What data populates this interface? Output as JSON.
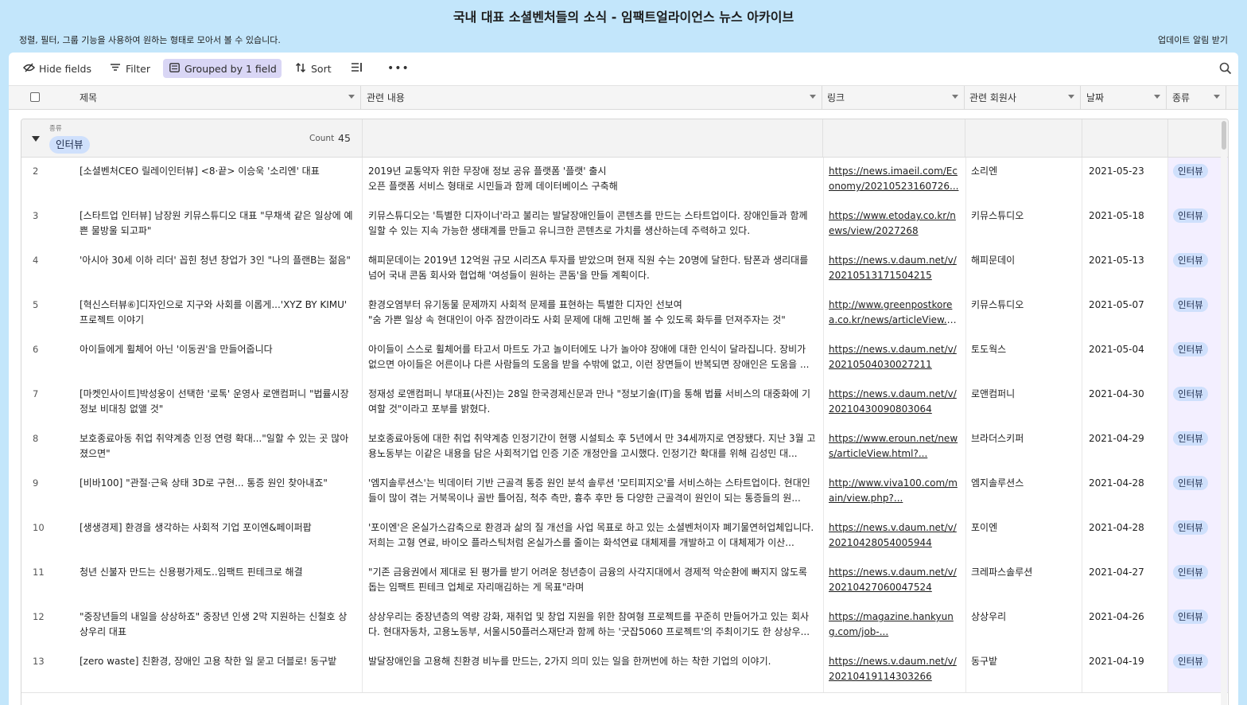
{
  "header": {
    "title": "국내 대표 소셜벤처들의 소식 - 임팩트얼라이언스 뉴스 아카이브",
    "description": "정렬, 필터, 그룹 기능을 사용하여 원하는 형태로 모아서 볼 수 있습니다.",
    "subscribe_label": "업데이트 알림 받기"
  },
  "toolbar": {
    "hide_fields": "Hide fields",
    "filter": "Filter",
    "grouped": "Grouped by 1 field",
    "sort": "Sort",
    "row_height_icon": "row-height-icon",
    "more_icon": "more-icon",
    "search_icon": "search-icon"
  },
  "columns": [
    "제목",
    "관련 내용",
    "링크",
    "관련 회원사",
    "날짜",
    "종류"
  ],
  "group": {
    "field_label": "종류",
    "value": "인터뷰",
    "count_label": "Count",
    "count": "45"
  },
  "rows": [
    {
      "num": "2",
      "title": "[소셜벤처CEO 릴레이인터뷰] <8·끝> 이승욱 '소리엔' 대표",
      "content": "2019년 교통약자 위한 무장애 정보 공유 플랫폼 '플랫' 출시\n오픈 플랫폼 서비스 형태로 시민들과 함께 데이터베이스 구축해",
      "link": "https://news.imaeil.com/Economy/20210523160726...",
      "member": "소리엔",
      "date": "2021-05-23",
      "type": "인터뷰"
    },
    {
      "num": "3",
      "title": "[스타트업 인터뷰] 남장원 키뮤스튜디오 대표 \"무채색 같은 일상에 예쁜 물방울 되고파\"",
      "content": "키뮤스튜디오는 '특별한 디자이너'라고 불리는 발달장애인들이 콘텐츠를 만드는 스타트업이다. 장애인들과 함께 일할 수 있는 지속 가능한 생태계를 만들고 유니크한 콘텐츠로 가치를 생산하는데 주력하고 있다.",
      "link": "https://www.etoday.co.kr/news/view/2027268",
      "member": "키뮤스튜디오",
      "date": "2021-05-18",
      "type": "인터뷰"
    },
    {
      "num": "4",
      "title": "'아시아 30세 이하 리더' 꼽힌 청년 창업가 3인 \"나의 플랜B는 젊음\"",
      "content": "해피문데이는 2019년 12억원 규모 시리즈A 투자를 받았으며 현재 직원 수는 20명에 달한다. 탐폰과 생리대를 넘어 국내 콘돔 회사와 협업해 '여성들이 원하는 콘돔'을 만들 계획이다.",
      "link": "https://news.v.daum.net/v/20210513171504215",
      "member": "해피문데이",
      "date": "2021-05-13",
      "type": "인터뷰"
    },
    {
      "num": "5",
      "title": "[혁신스터뷰⑥]디자인으로 지구와 사회를 이롭게...'XYZ BY KIMU' 프로젝트 이야기",
      "content": "환경오염부터 유기동물 문제까지 사회적 문제를 표현하는 특별한 디자인 선보여\n\"숨 가쁜 일상 속 현대인이 아주 잠깐이라도 사회 문제에 대해 고민해 볼 수 있도록 화두를 던져주자는 것\"",
      "link": "http://www.greenpostkorea.co.kr/news/articleView.ht...",
      "member": "키뮤스튜디오",
      "date": "2021-05-07",
      "type": "인터뷰"
    },
    {
      "num": "6",
      "title": "아이들에게 휠체어 아닌 '이동권'을 만들어줍니다",
      "content": "아이들이 스스로 휠체어를 타고서 마트도 가고 놀이터에도 나가 놀아야 장애에 대한 인식이 달라집니다. 장비가 없으면 아이들은 어른이나 다른 사람들의 도움을 받을 수밖에 없고, 이런 장면들이 반복되면 장애인은 도움을 ...",
      "link": "https://news.v.daum.net/v/20210504030027211",
      "member": "토도웍스",
      "date": "2021-05-04",
      "type": "인터뷰"
    },
    {
      "num": "7",
      "title": "[마켓인사이트]박성웅이 선택한 '로톡' 운영사 로앤컴퍼니 \"법률시장 정보 비대칭 없앨 것\"",
      "content": "정재성 로앤컴퍼니 부대표(사진)는 28일 한국경제신문과 만나 \"정보기술(IT)을 통해 법률 서비스의 대중화에 기여할 것\"이라고 포부를 밝혔다.",
      "link": "https://news.v.daum.net/v/20210430090803064",
      "member": "로앤컴퍼니",
      "date": "2021-04-30",
      "type": "인터뷰"
    },
    {
      "num": "8",
      "title": "보호종료아동 취업 취약계층 인정 연령 확대...\"일할 수 있는 곳 많아졌으면\"",
      "content": "보호종료아동에 대한 취업 취약계층 인정기간이 현행 시설퇴소 후 5년에서 만 34세까지로 연장됐다. 지난 3월 고용노동부는 이같은 내용을 담은 사회적기업 인증 기준 개정안을 고시했다. 인정기간 확대를 위해 김성민 대...",
      "link": "https://www.eroun.net/news/articleView.html?...",
      "member": "브라더스키퍼",
      "date": "2021-04-29",
      "type": "인터뷰"
    },
    {
      "num": "9",
      "title": "[비바100] \"관절·근육 상태 3D로 구현... 통증 원인 찾아내죠\"",
      "content": " '엠지솔루션스'는 빅데이터 기반 근골격 통증 원인 분석 솔루션 '모티피지오'를 서비스하는 스타트업이다. 현대인들이 많이 겪는 거북목이나 골반 틀어짐, 척추 측만, 흉추 후만 등 다양한 근골격이 원인이 되는 통증들의 원...",
      "link": "http://www.viva100.com/main/view.php?...",
      "member": "엠지솔루션스",
      "date": "2021-04-28",
      "type": "인터뷰"
    },
    {
      "num": "10",
      "title": "[생생경제] 환경을 생각하는 사회적 기업 포이엔&페이퍼팝",
      "content": "'포이엔'은 온실가스감축으로 환경과 삶의 질 개선을 사업 목표로 하고 있는 소셜벤처이자 폐기물연허업체입니다. 저희는 고형 연료, 바이오 플라스틱처럼 온실가스를 줄이는 화석연료 대체제를 개발하고 이 대체제가 이산...",
      "link": "https://news.v.daum.net/v/20210428054005944",
      "member": "포이엔",
      "date": "2021-04-28",
      "type": "인터뷰"
    },
    {
      "num": "11",
      "title": "청년 신불자 만드는 신용평가제도..임팩트 핀테크로 해결",
      "content": "\"기존 금융권에서 제대로 된 평가를 받기 어려운 청년층이 금융의 사각지대에서 경제적 악순환에 빠지지 않도록 돕는 임팩트 핀테크 업체로 자리매김하는 게 목표\"라며",
      "link": "https://news.v.daum.net/v/20210427060047524",
      "member": "크레파스솔루션",
      "date": "2021-04-27",
      "type": "인터뷰"
    },
    {
      "num": "12",
      "title": "\"중장년들의 내일을 상상하죠\" 중장년 인생 2막 지원하는 신철호 상상우리 대표",
      "content": "상상우리는 중장년층의 역량 강화, 재취업 및 창업 지원을 위한 참여형 프로젝트를 꾸준히 만들어가고 있는 회사다. 현대자동차, 고용노동부, 서울시50플러스재단과 함께 하는 '굿잡5060 프로젝트'의 주최이기도 한 상상우...",
      "link": "https://magazine.hankyung.com/job-...",
      "member": "상상우리",
      "date": "2021-04-26",
      "type": "인터뷰"
    },
    {
      "num": "13",
      "title": "[zero waste] 친환경, 장애인 고용 착한 일 묻고 더블로! 동구밭",
      "content": "발달장애인을 고용해 친환경 비누를 만드는, 2가지 의미 있는 일을 한꺼번에 하는 착한 기업의 이야기.",
      "link": "https://news.v.daum.net/v/20210419114303266",
      "member": "동구밭",
      "date": "2021-04-19",
      "type": "인터뷰"
    }
  ]
}
